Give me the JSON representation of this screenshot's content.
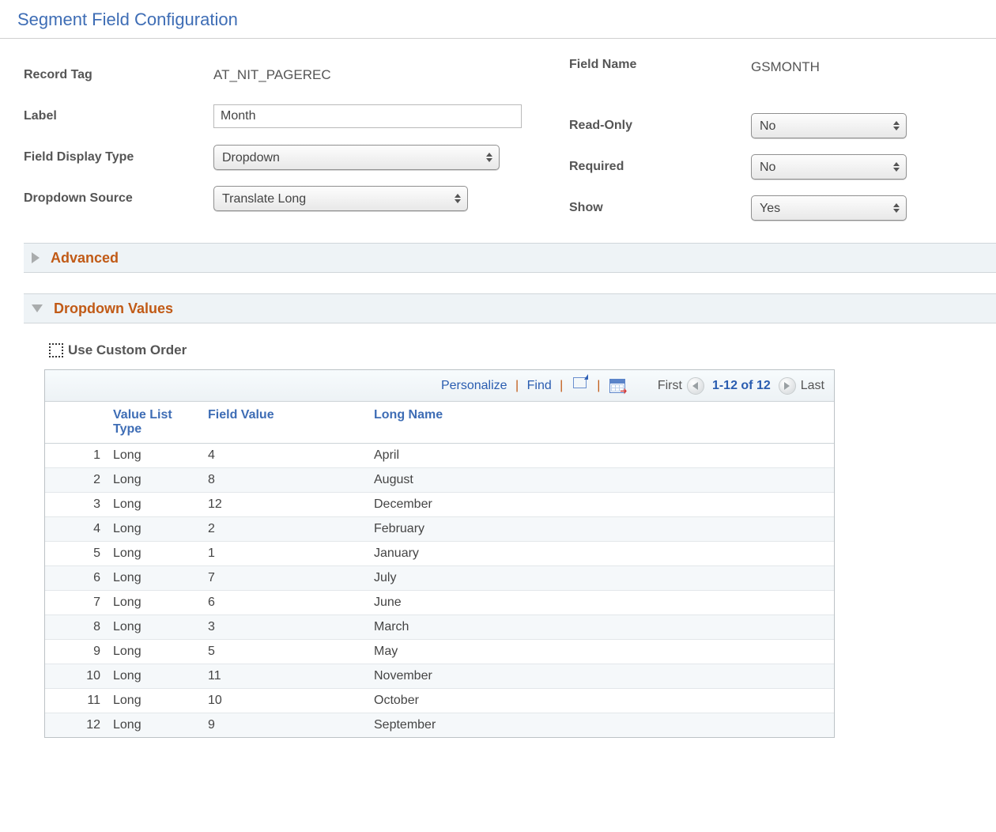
{
  "page_title": "Segment Field Configuration",
  "left": {
    "record_tag_label": "Record Tag",
    "record_tag_value": "AT_NIT_PAGEREC",
    "label_label": "Label",
    "label_value": "Month",
    "display_type_label": "Field Display Type",
    "display_type_value": "Dropdown",
    "dropdown_source_label": "Dropdown Source",
    "dropdown_source_value": "Translate Long"
  },
  "right": {
    "field_name_label": "Field Name",
    "field_name_value": "GSMONTH",
    "read_only_label": "Read-Only",
    "read_only_value": "No",
    "required_label": "Required",
    "required_value": "No",
    "show_label": "Show",
    "show_value": "Yes"
  },
  "sections": {
    "advanced": "Advanced",
    "dropdown_values": "Dropdown Values"
  },
  "custom_order_label": "Use Custom Order",
  "toolbar": {
    "personalize": "Personalize",
    "find": "Find",
    "first": "First",
    "counter": "1-12 of 12",
    "last": "Last"
  },
  "columns": {
    "value_list_type": "Value List Type",
    "field_value": "Field Value",
    "long_name": "Long Name"
  },
  "rows": [
    {
      "n": "1",
      "type": "Long",
      "val": "4",
      "name": "April"
    },
    {
      "n": "2",
      "type": "Long",
      "val": "8",
      "name": "August"
    },
    {
      "n": "3",
      "type": "Long",
      "val": "12",
      "name": "December"
    },
    {
      "n": "4",
      "type": "Long",
      "val": "2",
      "name": "February"
    },
    {
      "n": "5",
      "type": "Long",
      "val": "1",
      "name": "January"
    },
    {
      "n": "6",
      "type": "Long",
      "val": "7",
      "name": "July"
    },
    {
      "n": "7",
      "type": "Long",
      "val": "6",
      "name": "June"
    },
    {
      "n": "8",
      "type": "Long",
      "val": "3",
      "name": "March"
    },
    {
      "n": "9",
      "type": "Long",
      "val": "5",
      "name": "May"
    },
    {
      "n": "10",
      "type": "Long",
      "val": "11",
      "name": "November"
    },
    {
      "n": "11",
      "type": "Long",
      "val": "10",
      "name": "October"
    },
    {
      "n": "12",
      "type": "Long",
      "val": "9",
      "name": "September"
    }
  ]
}
